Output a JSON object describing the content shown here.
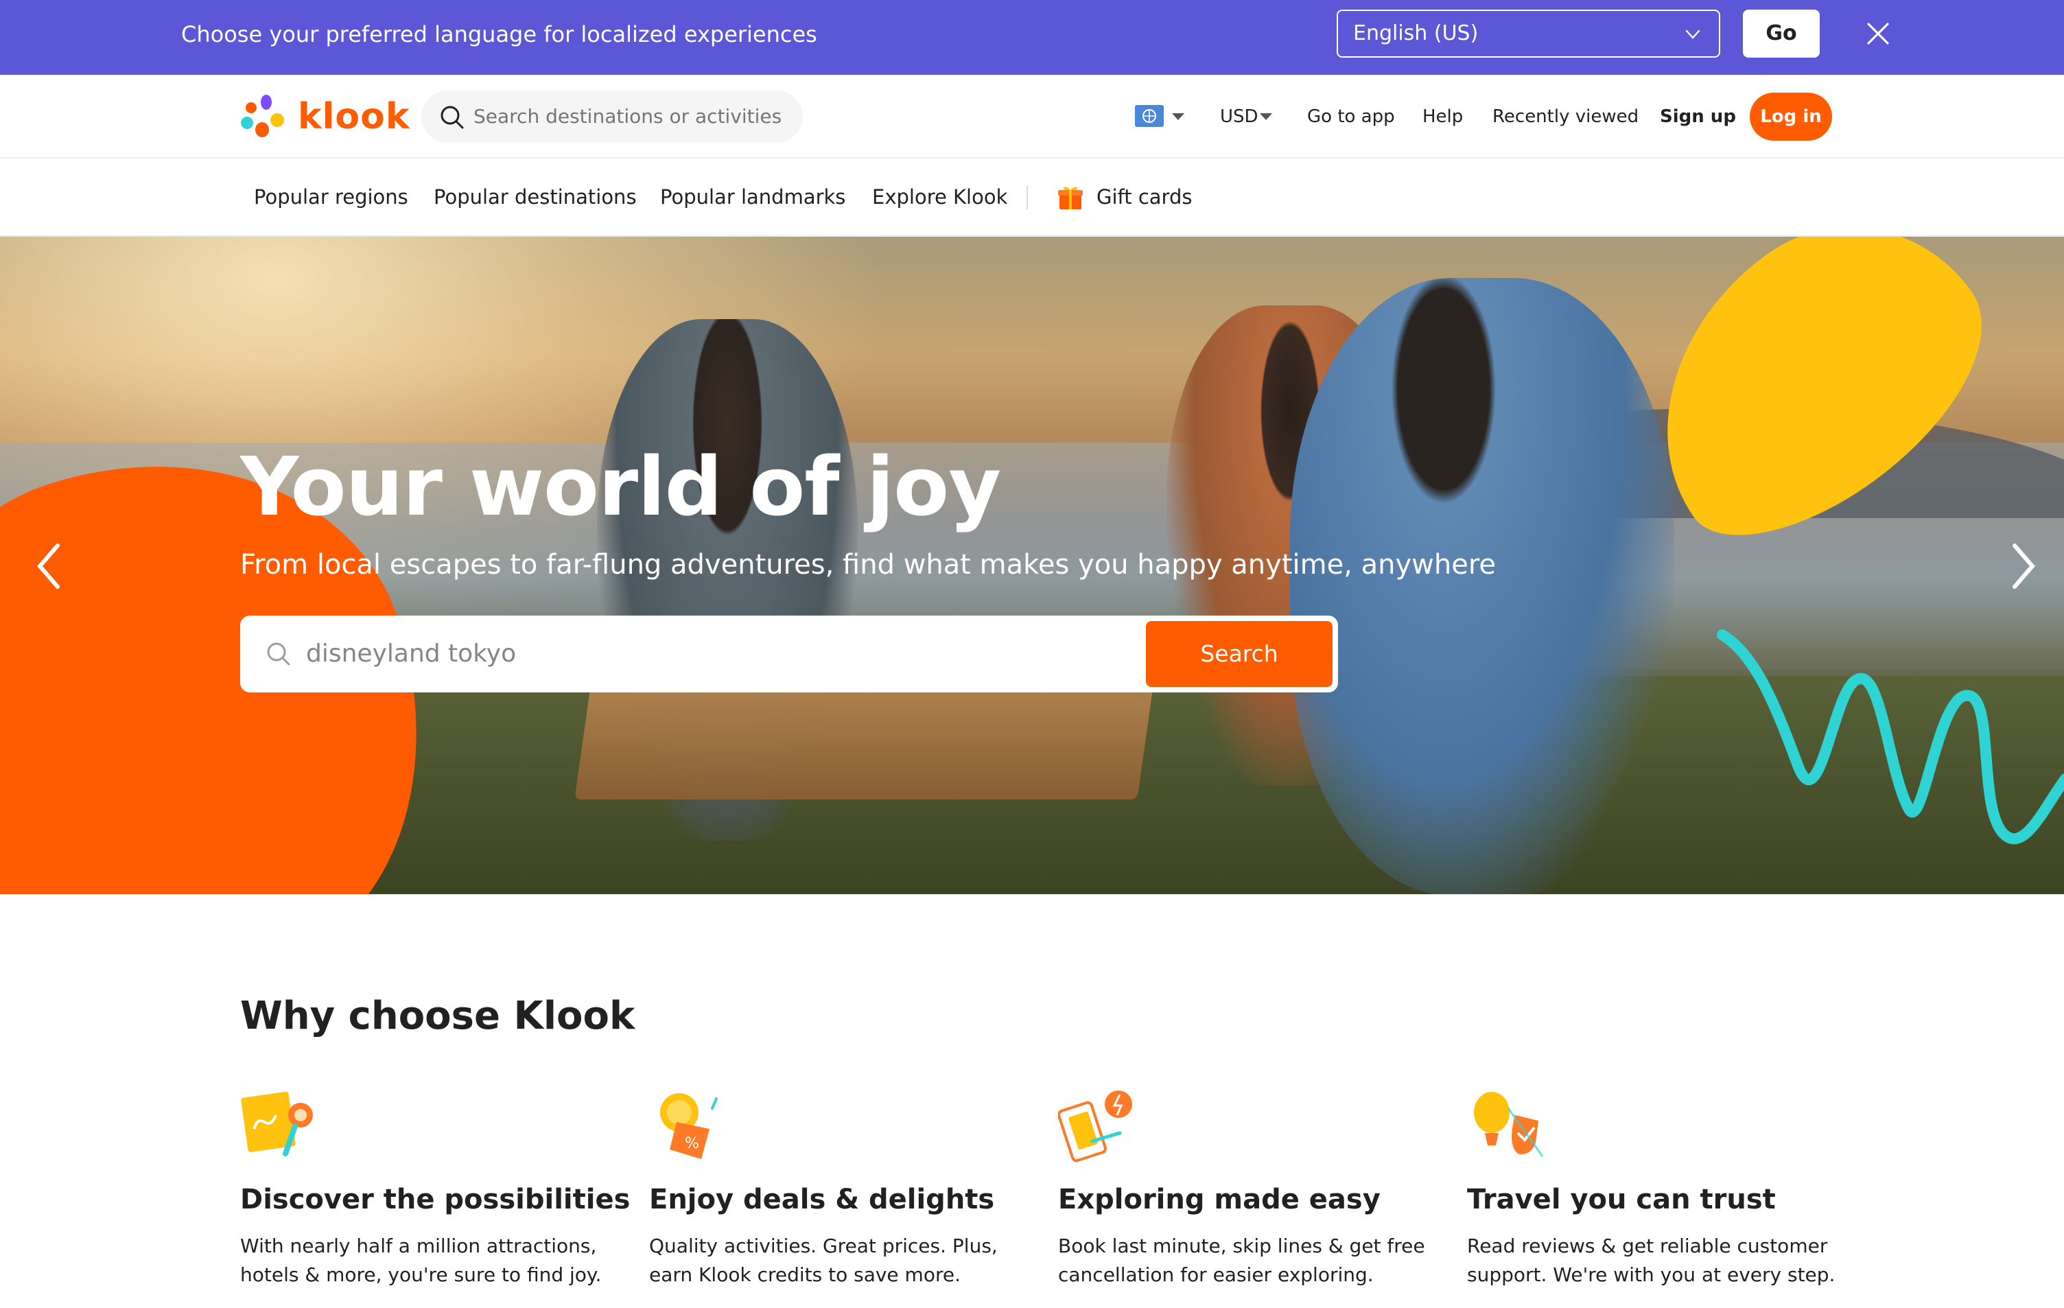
{
  "language_banner": {
    "message": "Choose your preferred language for localized experiences",
    "selected_language": "English (US)",
    "go_label": "Go"
  },
  "header": {
    "logo_text": "klook",
    "search_placeholder": "Search destinations or activities",
    "currency": "USD",
    "links": {
      "go_to_app": "Go to app",
      "help": "Help",
      "recently_viewed": "Recently viewed",
      "sign_up": "Sign up"
    },
    "login_label": "Log in"
  },
  "subnav": {
    "items": [
      "Popular regions",
      "Popular destinations",
      "Popular landmarks",
      "Explore Klook"
    ],
    "gift_cards": "Gift cards"
  },
  "hero": {
    "title": "Your world of joy",
    "subtitle": "From local escapes to far-flung adventures, find what makes you happy anytime, anywhere",
    "search_value": "disneyland tokyo",
    "search_button": "Search"
  },
  "why": {
    "title": "Why choose Klook",
    "features": [
      {
        "icon": "map-icon",
        "title": "Discover the possibilities",
        "desc": "With nearly half a million attractions, hotels & more, you're sure to find joy."
      },
      {
        "icon": "deal-tag-icon",
        "title": "Enjoy deals & delights",
        "desc": "Quality activities. Great prices. Plus, earn Klook credits to save more."
      },
      {
        "icon": "phone-booking-icon",
        "title": "Exploring made easy",
        "desc": "Book last minute, skip lines & get free cancellation for easier exploring."
      },
      {
        "icon": "balloon-shield-icon",
        "title": "Travel you can trust",
        "desc": "Read reviews & get reliable customer support. We're with you at every step."
      }
    ]
  },
  "colors": {
    "brand_orange": "#ff5b00",
    "banner_purple": "#5b57d6",
    "accent_yellow": "#ffc20e",
    "accent_teal": "#2fd3d3"
  }
}
